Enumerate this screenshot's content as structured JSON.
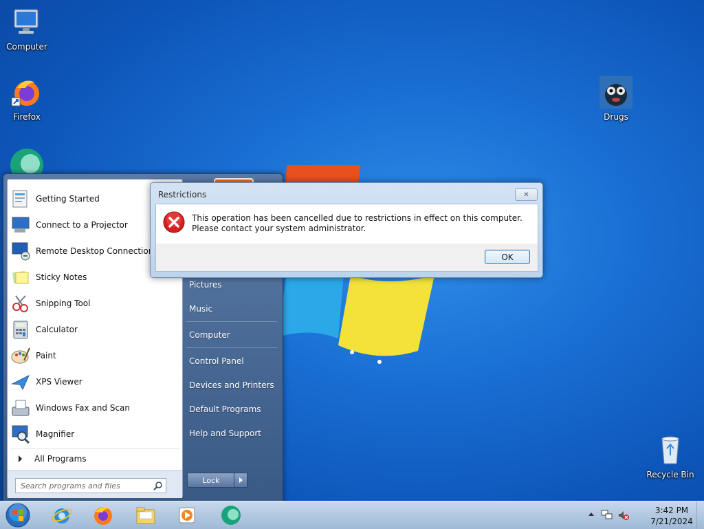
{
  "desktop": {
    "icons": [
      {
        "label": "Computer",
        "icon": "computer-icon"
      },
      {
        "label": "Firefox",
        "icon": "firefox-icon"
      },
      {
        "label": "Drugs",
        "icon": "drugs-folder-icon"
      },
      {
        "label": "Recycle Bin",
        "icon": "recycle-bin-icon"
      }
    ]
  },
  "start_menu": {
    "programs": [
      {
        "label": "Getting Started",
        "icon": "getting-started-icon"
      },
      {
        "label": "Connect to a Projector",
        "icon": "projector-icon"
      },
      {
        "label": "Remote Desktop Connection",
        "icon": "remote-desktop-icon"
      },
      {
        "label": "Sticky Notes",
        "icon": "sticky-notes-icon"
      },
      {
        "label": "Snipping Tool",
        "icon": "snipping-tool-icon"
      },
      {
        "label": "Calculator",
        "icon": "calculator-icon"
      },
      {
        "label": "Paint",
        "icon": "paint-icon"
      },
      {
        "label": "XPS Viewer",
        "icon": "xps-viewer-icon"
      },
      {
        "label": "Windows Fax and Scan",
        "icon": "fax-scan-icon"
      },
      {
        "label": "Magnifier",
        "icon": "magnifier-icon"
      }
    ],
    "all_programs": "All Programs",
    "search_placeholder": "Search programs and files",
    "right_links": [
      "Pictures",
      "Music",
      "Computer",
      "Control Panel",
      "Devices and Printers",
      "Default Programs",
      "Help and Support"
    ],
    "lock_label": "Lock"
  },
  "dialog": {
    "title": "Restrictions",
    "message": "This operation has been cancelled due to restrictions in effect on this computer. Please contact your system administrator.",
    "ok_label": "OK",
    "icon": "error-icon"
  },
  "taskbar": {
    "pinned": [
      "internet-explorer-icon",
      "firefox-icon",
      "file-explorer-icon",
      "media-player-icon",
      "app-icon"
    ],
    "clock_time": "3:42 PM",
    "clock_date": "7/21/2024"
  },
  "colors": {
    "accent": "#1a6fd4",
    "error": "#d81e1e"
  }
}
